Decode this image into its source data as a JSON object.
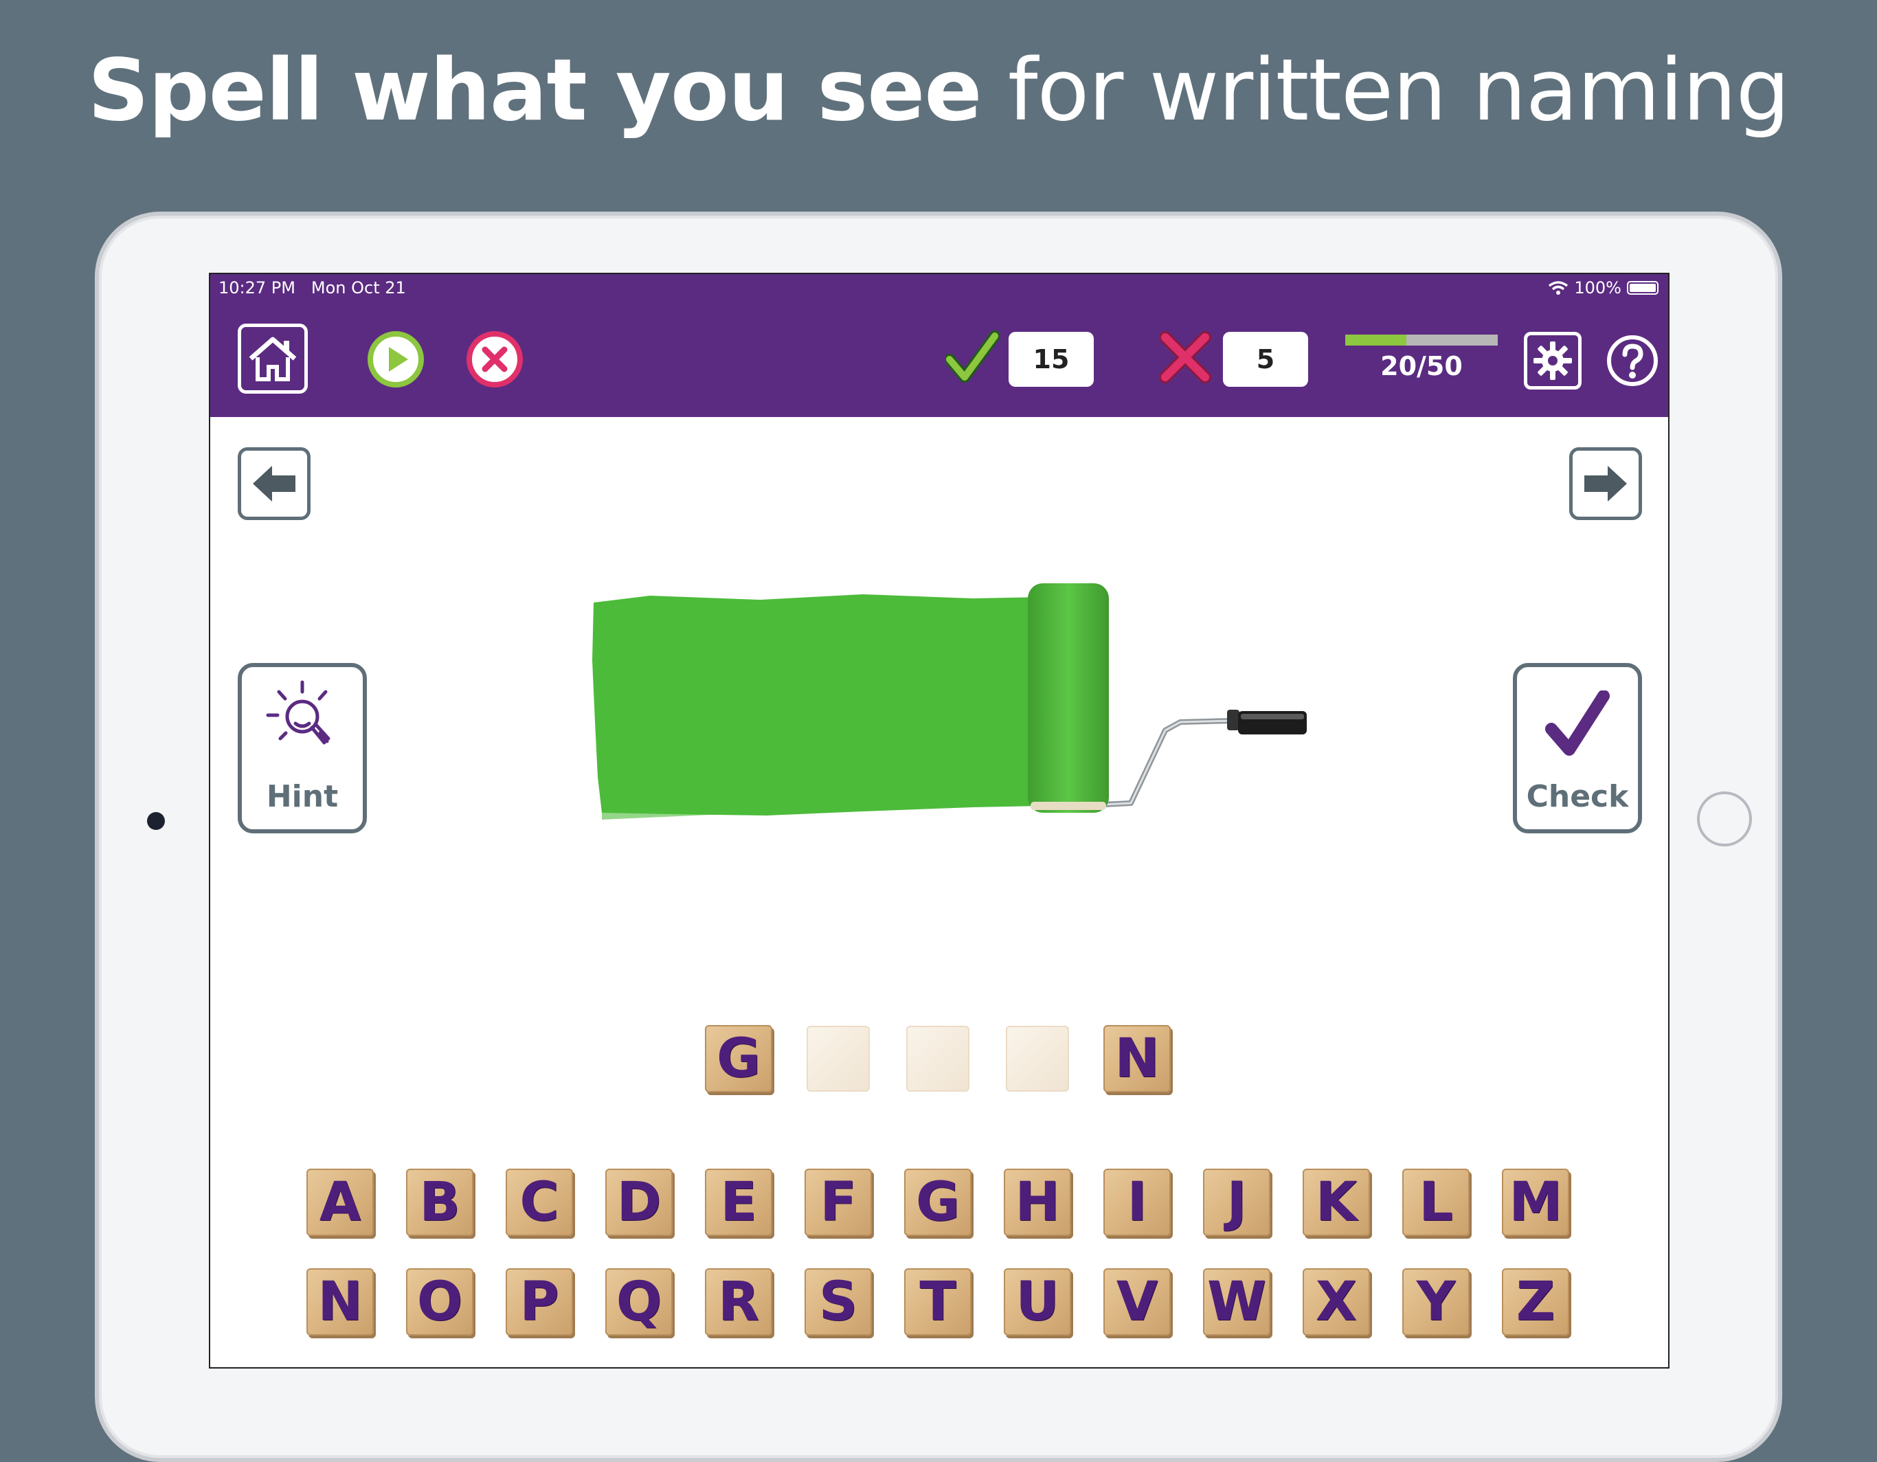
{
  "headline": {
    "bold": "Spell what you see",
    "light": " for written naming"
  },
  "status_bar": {
    "time": "10:27 PM",
    "date": "Mon Oct 21",
    "battery": "100%"
  },
  "toolbar": {
    "home_icon": "home-icon",
    "play_icon": "play-icon",
    "stop_icon": "close-circle-icon",
    "correct_count": "15",
    "wrong_count": "5",
    "progress_label": "20/50",
    "progress_fraction": 0.4,
    "settings_icon": "gear-icon",
    "help_icon": "question-icon"
  },
  "hint": {
    "label": "Hint",
    "icon": "lightbulb-icon"
  },
  "check": {
    "label": "Check",
    "icon": "checkmark-icon"
  },
  "picture": {
    "subject": "green paint roller",
    "paint_color": "#4cbb3a"
  },
  "answer_slots": [
    "G",
    "",
    "",
    "",
    "N"
  ],
  "keyboard": {
    "row1": [
      "A",
      "B",
      "C",
      "D",
      "E",
      "F",
      "G",
      "H",
      "I",
      "J",
      "K",
      "L",
      "M"
    ],
    "row2": [
      "N",
      "O",
      "P",
      "Q",
      "R",
      "S",
      "T",
      "U",
      "V",
      "W",
      "X",
      "Y",
      "Z"
    ]
  },
  "colors": {
    "brand_purple": "#5b2b81",
    "correct_green": "#8dc63f",
    "wrong_pink": "#e0306a",
    "frame_gray": "#5f6f78"
  }
}
